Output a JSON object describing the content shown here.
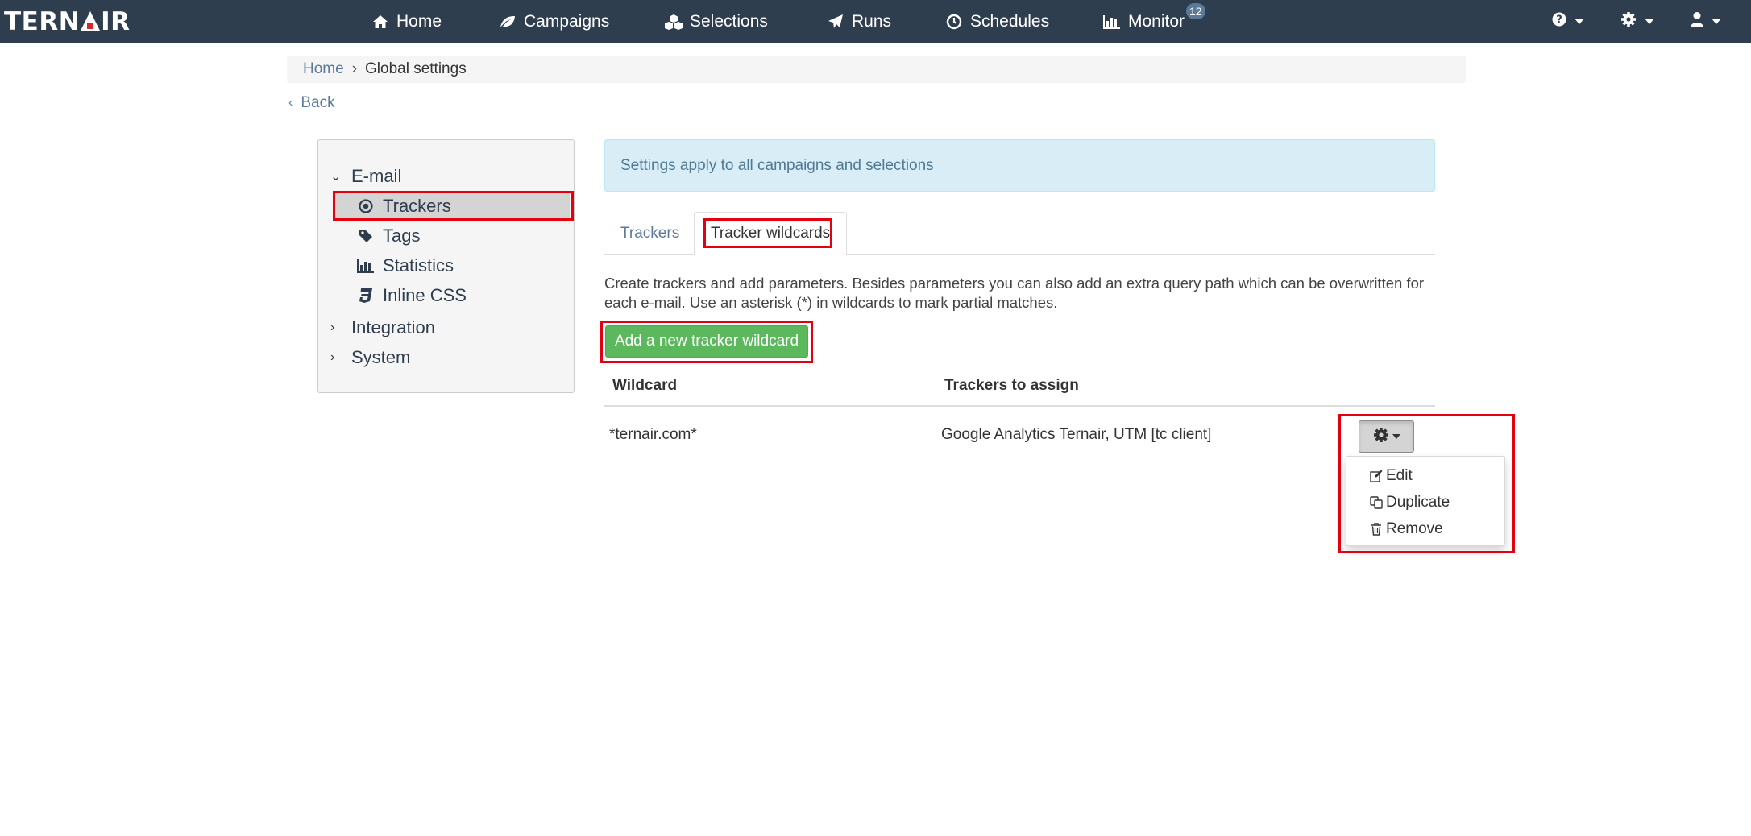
{
  "navbar": {
    "logo": {
      "part1": "TERN",
      "part2": "IR"
    },
    "items": [
      {
        "label": "Home",
        "icon": "home-icon"
      },
      {
        "label": "Campaigns",
        "icon": "leaf-icon"
      },
      {
        "label": "Selections",
        "icon": "cubes-icon"
      },
      {
        "label": "Runs",
        "icon": "paper-plane-icon"
      },
      {
        "label": "Schedules",
        "icon": "clock-icon"
      },
      {
        "label": "Monitor",
        "icon": "bar-chart-icon",
        "badge": "12"
      }
    ],
    "right": [
      {
        "icon": "help-icon"
      },
      {
        "icon": "gear-icon"
      },
      {
        "icon": "user-icon"
      }
    ],
    "colors": {
      "background": "#2f3e4e",
      "text": "#ffffff",
      "accent": "#d9262c"
    }
  },
  "breadcrumb": {
    "home": "Home",
    "current": "Global settings"
  },
  "back": {
    "label": "Back"
  },
  "sidebar": {
    "groups": [
      {
        "label": "E-mail",
        "expanded": true,
        "items": [
          {
            "label": "Trackers",
            "icon": "dot-circle-icon",
            "active": true
          },
          {
            "label": "Tags",
            "icon": "tag-icon"
          },
          {
            "label": "Statistics",
            "icon": "bar-chart-icon"
          },
          {
            "label": "Inline CSS",
            "icon": "css3-icon"
          }
        ]
      },
      {
        "label": "Integration",
        "expanded": false
      },
      {
        "label": "System",
        "expanded": false
      }
    ]
  },
  "main": {
    "alert": "Settings apply to all campaigns and selections",
    "tabs": [
      {
        "label": "Trackers",
        "active": false
      },
      {
        "label": "Tracker wildcards",
        "active": true
      }
    ],
    "description_line1": "Create trackers and add parameters. Besides parameters you can also add an extra query path which can be overwritten for",
    "description_line2": "each e-mail. Use an asterisk (*) in wildcards to mark partial matches.",
    "add_button": "Add a new tracker wildcard",
    "table": {
      "columns": [
        "Wildcard",
        "Trackers to assign"
      ],
      "rows": [
        {
          "wildcard": "*ternair.com*",
          "trackers": "Google Analytics Ternair, UTM [tc client]"
        }
      ]
    },
    "row_menu": {
      "items": [
        {
          "label": "Edit",
          "icon": "edit-icon"
        },
        {
          "label": "Duplicate",
          "icon": "copy-icon"
        },
        {
          "label": "Remove",
          "icon": "trash-icon"
        }
      ]
    },
    "colors": {
      "alert_bg": "#d9edf7",
      "success": "#5cb85c",
      "link": "#5b7a9a",
      "highlight_border": "#e3000f"
    }
  }
}
